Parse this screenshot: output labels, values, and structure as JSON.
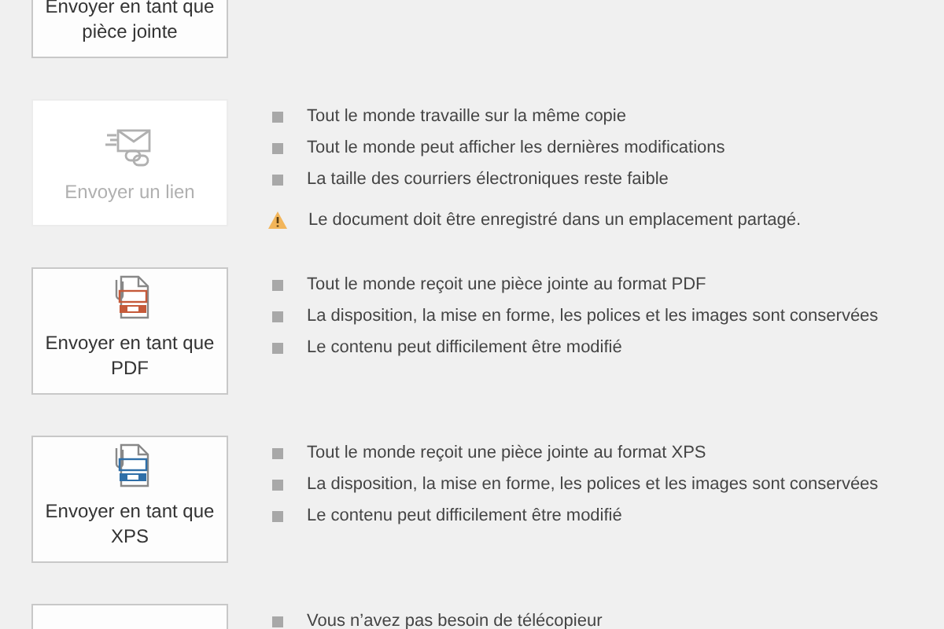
{
  "options": [
    {
      "kind": "attachment",
      "label": "Envoyer en tant que pièce jointe",
      "disabled": false
    },
    {
      "kind": "link",
      "label": "Envoyer un lien",
      "disabled": true,
      "bullets": [
        "Tout le monde travaille sur la même copie",
        "Tout le monde peut afficher les dernières modifications",
        "La taille des courriers électroniques reste faible"
      ],
      "warning": "Le document doit être enregistré dans un emplacement partagé."
    },
    {
      "kind": "pdf",
      "label": "Envoyer en tant que PDF",
      "disabled": false,
      "bullets": [
        "Tout le monde reçoit une pièce jointe au format PDF",
        "La disposition, la mise en forme, les polices et les images sont conservées",
        "Le contenu peut difficilement être modifié"
      ]
    },
    {
      "kind": "xps",
      "label": "Envoyer en tant que XPS",
      "disabled": false,
      "bullets": [
        "Tout le monde reçoit une pièce jointe au format XPS",
        "La disposition, la mise en forme, les polices et les images sont conservées",
        "Le contenu peut difficilement être modifié"
      ]
    },
    {
      "kind": "fax",
      "disabled": false,
      "bullets": [
        "Vous n’avez pas besoin de télécopieur"
      ]
    }
  ]
}
